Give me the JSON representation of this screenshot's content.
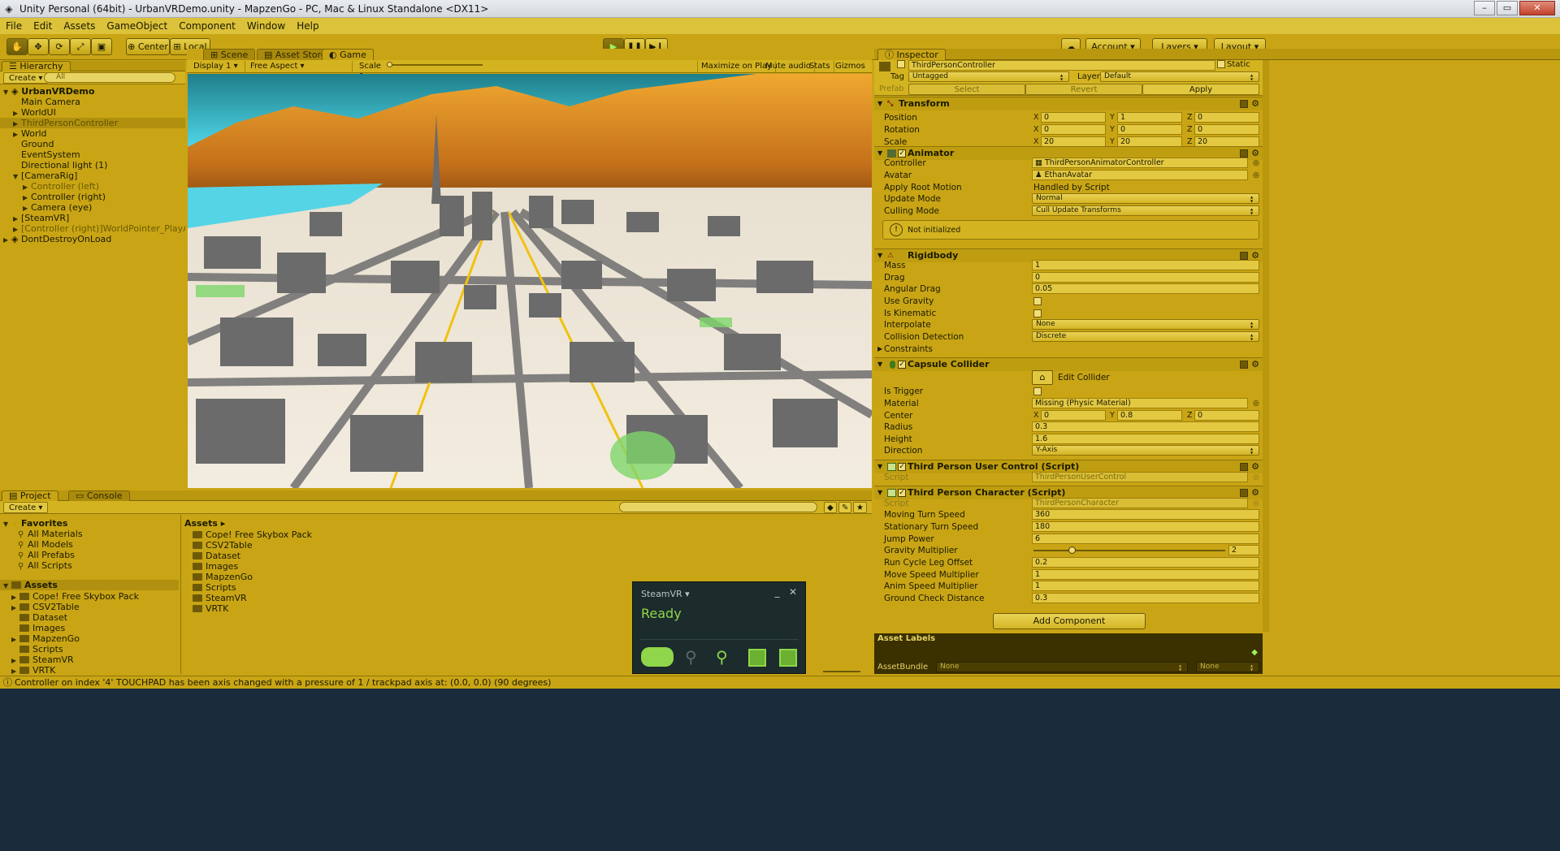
{
  "window": {
    "title": "Unity Personal (64bit) - UrbanVRDemo.unity - MapzenGo - PC, Mac & Linux Standalone <DX11>"
  },
  "menu": [
    "File",
    "Edit",
    "Assets",
    "GameObject",
    "Component",
    "Window",
    "Help"
  ],
  "toolbar": {
    "pivot": "Center",
    "space": "Local",
    "account": "Account",
    "layers": "Layers",
    "layout": "Layout"
  },
  "hierarchy": {
    "tab": "Hierarchy",
    "create": "Create",
    "search_placeholder": "All",
    "scene": "UrbanVRDemo",
    "items": [
      {
        "label": "Main Camera",
        "indent": 1,
        "arrow": ""
      },
      {
        "label": "WorldUI",
        "indent": 1,
        "arrow": "▶"
      },
      {
        "label": "ThirdPersonController",
        "indent": 1,
        "arrow": "▶",
        "selected": true
      },
      {
        "label": "World",
        "indent": 1,
        "arrow": "▶"
      },
      {
        "label": "Ground",
        "indent": 1,
        "arrow": ""
      },
      {
        "label": "EventSystem",
        "indent": 1,
        "arrow": ""
      },
      {
        "label": "Directional light (1)",
        "indent": 1,
        "arrow": ""
      },
      {
        "label": "[CameraRig]",
        "indent": 1,
        "arrow": "▼"
      },
      {
        "label": "Controller (left)",
        "indent": 2,
        "arrow": "▶",
        "dim": true
      },
      {
        "label": "Controller (right)",
        "indent": 2,
        "arrow": "▶"
      },
      {
        "label": "Camera (eye)",
        "indent": 2,
        "arrow": "▶"
      },
      {
        "label": "[SteamVR]",
        "indent": 1,
        "arrow": "▶"
      },
      {
        "label": "[Controller (right)]WorldPointer_PlayAreaCursor",
        "indent": 1,
        "arrow": "▶",
        "dim": true
      }
    ],
    "dontdestroy": "DontDestroyOnLoad"
  },
  "views": {
    "tabs": [
      "Scene",
      "Asset Store",
      "Game"
    ],
    "display": "Display 1",
    "aspect": "Free Aspect",
    "scale_label": "Scale",
    "scale_value": "1x",
    "maximize": "Maximize on Play",
    "mute": "Mute audio",
    "stats": "Stats",
    "gizmos": "Gizmos"
  },
  "project": {
    "tabs": [
      "Project",
      "Console"
    ],
    "create": "Create",
    "favorites_title": "Favorites",
    "favorites": [
      "All Materials",
      "All Models",
      "All Prefabs",
      "All Scripts"
    ],
    "assets_title": "Assets",
    "tree": [
      "Cope! Free Skybox Pack",
      "CSV2Table",
      "Dataset",
      "Images",
      "MapzenGo",
      "Scripts",
      "SteamVR",
      "VRTK"
    ],
    "breadcrumb": "Assets",
    "contents": [
      "Cope! Free Skybox Pack",
      "CSV2Table",
      "Dataset",
      "Images",
      "MapzenGo",
      "Scripts",
      "SteamVR",
      "VRTK"
    ]
  },
  "steamvr": {
    "title": "SteamVR",
    "status": "Ready"
  },
  "inspector": {
    "tab": "Inspector",
    "object_name": "ThirdPersonController",
    "static": "Static",
    "tag_label": "Tag",
    "tag": "Untagged",
    "layer_label": "Layer",
    "layer": "Default",
    "prefab_label": "Prefab",
    "prefab_select": "Select",
    "prefab_revert": "Revert",
    "prefab_apply": "Apply",
    "transform": {
      "title": "Transform",
      "position_label": "Position",
      "position": [
        "0",
        "1",
        "0"
      ],
      "rotation_label": "Rotation",
      "rotation": [
        "0",
        "0",
        "0"
      ],
      "scale_label": "Scale",
      "scale": [
        "20",
        "20",
        "20"
      ]
    },
    "animator": {
      "title": "Animator",
      "controller_label": "Controller",
      "controller": "ThirdPersonAnimatorController",
      "avatar_label": "Avatar",
      "avatar": "EthanAvatar",
      "root_label": "Apply Root Motion",
      "root": "Handled by Script",
      "update_label": "Update Mode",
      "update": "Normal",
      "culling_label": "Culling Mode",
      "culling": "Cull Update Transforms",
      "warning": "Not initialized"
    },
    "rigidbody": {
      "title": "Rigidbody",
      "mass_label": "Mass",
      "mass": "1",
      "drag_label": "Drag",
      "drag": "0",
      "angular_label": "Angular Drag",
      "angular": "0.05",
      "gravity_label": "Use Gravity",
      "kinematic_label": "Is Kinematic",
      "interp_label": "Interpolate",
      "interp": "None",
      "collision_label": "Collision Detection",
      "collision": "Discrete",
      "constraints_label": "Constraints"
    },
    "capsule": {
      "title": "Capsule Collider",
      "edit": "Edit Collider",
      "trigger_label": "Is Trigger",
      "material_label": "Material",
      "material": "Missing (Physic Material)",
      "center_label": "Center",
      "center": [
        "0",
        "0.8",
        "0"
      ],
      "radius_label": "Radius",
      "radius": "0.3",
      "height_label": "Height",
      "height": "1.6",
      "direction_label": "Direction",
      "direction": "Y-Axis"
    },
    "tpuc": {
      "title": "Third Person User Control (Script)",
      "script_label": "Script",
      "script": "ThirdPersonUserControl"
    },
    "tpc": {
      "title": "Third Person Character (Script)",
      "script_label": "Script",
      "script": "ThirdPersonCharacter",
      "moving_label": "Moving Turn Speed",
      "moving": "360",
      "stationary_label": "Stationary Turn Speed",
      "stationary": "180",
      "jump_label": "Jump Power",
      "jump": "6",
      "gravity_label": "Gravity Multiplier",
      "gravity": "2",
      "gravity_slider": 0.2,
      "runcycle_label": "Run Cycle Leg Offset",
      "runcycle": "0.2",
      "move_label": "Move Speed Multiplier",
      "move": "1",
      "anim_label": "Anim Speed Multiplier",
      "anim": "1",
      "ground_label": "Ground Check Distance",
      "ground": "0.3"
    },
    "add_component": "Add Component",
    "asset_labels": "Asset Labels",
    "asset_bundle_label": "AssetBundle",
    "asset_bundle": "None",
    "asset_variant": "None"
  },
  "status": "Controller on index '4' TOUCHPAD has been axis changed with a pressure of 1 / trackpad axis at: (0.0, 0.0) (90 degrees)"
}
